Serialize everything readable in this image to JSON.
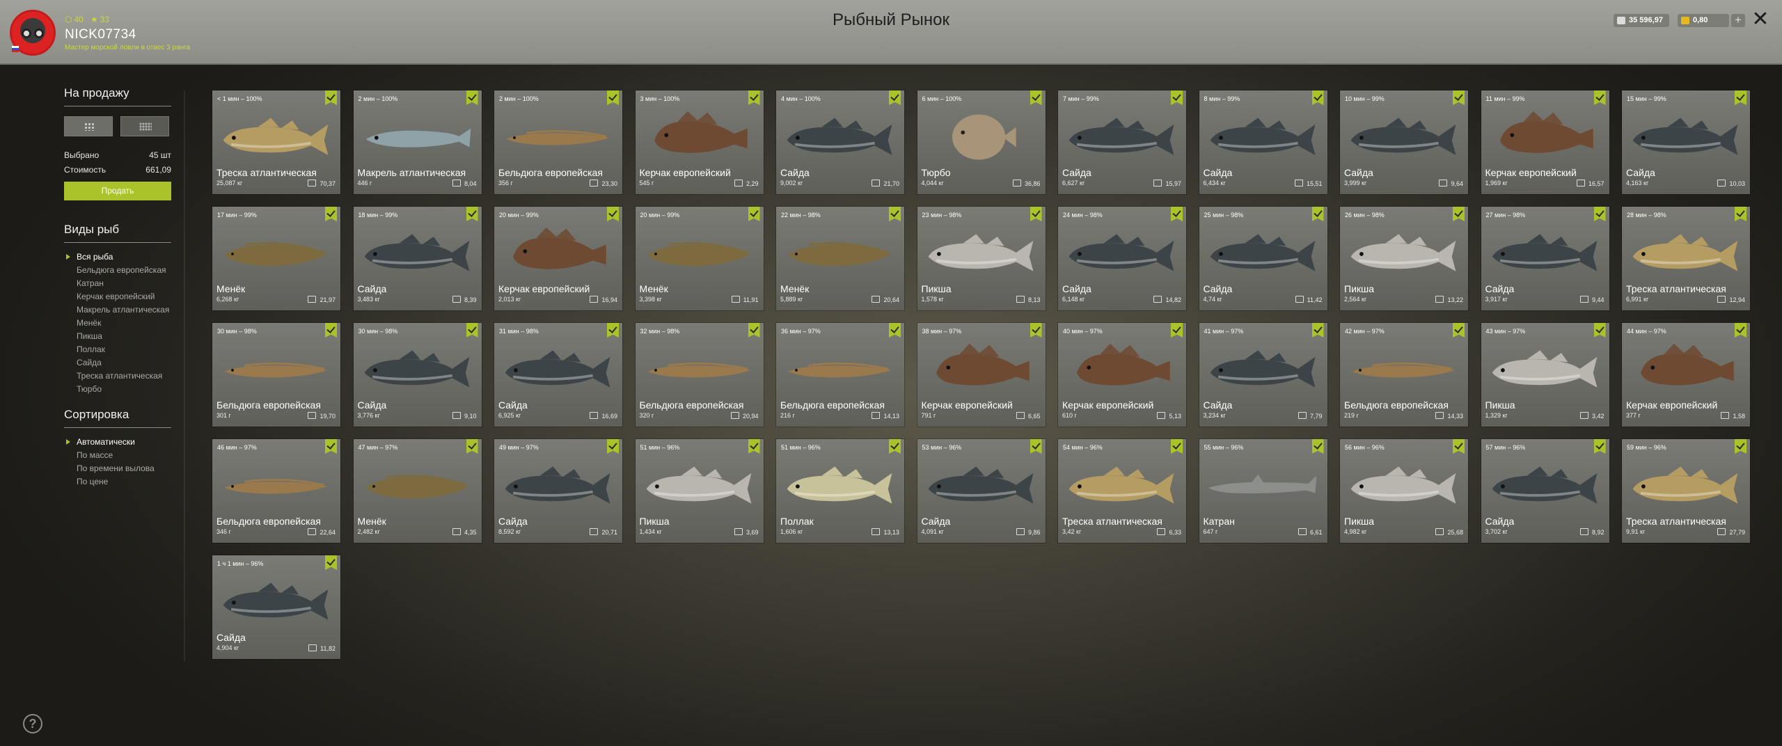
{
  "header": {
    "title": "Рыбный Рынок",
    "username": "NICK07734",
    "rank": "Мастер морской ловли в отвес 3 ранга",
    "stat_level": "40",
    "stat_stars": "33",
    "money": "35 596,97",
    "gold": "0,80",
    "plus": "+",
    "close": "✕"
  },
  "sidebar": {
    "sale_title": "На продажу",
    "selected_label": "Выбрано",
    "selected_value": "45 шт",
    "cost_label": "Стоимость",
    "cost_value": "661,09",
    "sell_button": "Продать",
    "types_title": "Виды рыб",
    "types": [
      "Вся рыба",
      "Бельдюга европейская",
      "Катран",
      "Керчак европейский",
      "Макрель атлантическая",
      "Менёк",
      "Пикша",
      "Поллак",
      "Сайда",
      "Треска атлантическая",
      "Тюрбо"
    ],
    "sort_title": "Сортировка",
    "sorts": [
      "Автоматически",
      "По массе",
      "По времени вылова",
      "По цене"
    ],
    "help": "?"
  },
  "cards": [
    {
      "time": "< 1 мин – 100%",
      "name": "Треска атлантическая",
      "weight": "25,087 кг",
      "price": "70,37"
    },
    {
      "time": "2 мин – 100%",
      "name": "Макрель атлантическая",
      "weight": "446 г",
      "price": "8,04"
    },
    {
      "time": "2 мин – 100%",
      "name": "Бельдюга европейская",
      "weight": "356 г",
      "price": "23,30"
    },
    {
      "time": "3 мин – 100%",
      "name": "Керчак европейский",
      "weight": "545 г",
      "price": "2,29"
    },
    {
      "time": "4 мин – 100%",
      "name": "Сайда",
      "weight": "9,002 кг",
      "price": "21,70"
    },
    {
      "time": "6 мин – 100%",
      "name": "Тюрбо",
      "weight": "4,044 кг",
      "price": "36,86"
    },
    {
      "time": "7 мин – 99%",
      "name": "Сайда",
      "weight": "6,627 кг",
      "price": "15,97"
    },
    {
      "time": "8 мин – 99%",
      "name": "Сайда",
      "weight": "6,434 кг",
      "price": "15,51"
    },
    {
      "time": "10 мин – 99%",
      "name": "Сайда",
      "weight": "3,999 кг",
      "price": "9,64"
    },
    {
      "time": "11 мин – 99%",
      "name": "Керчак европейский",
      "weight": "1,969 кг",
      "price": "16,57"
    },
    {
      "time": "15 мин – 99%",
      "name": "Сайда",
      "weight": "4,163 кг",
      "price": "10,03"
    },
    {
      "time": "17 мин – 99%",
      "name": "Менёк",
      "weight": "6,268 кг",
      "price": "21,97"
    },
    {
      "time": "18 мин – 99%",
      "name": "Сайда",
      "weight": "3,483 кг",
      "price": "8,39"
    },
    {
      "time": "20 мин – 99%",
      "name": "Керчак европейский",
      "weight": "2,013 кг",
      "price": "16,94"
    },
    {
      "time": "20 мин – 99%",
      "name": "Менёк",
      "weight": "3,398 кг",
      "price": "11,91"
    },
    {
      "time": "22 мин – 98%",
      "name": "Менёк",
      "weight": "5,889 кг",
      "price": "20,64"
    },
    {
      "time": "23 мин – 98%",
      "name": "Пикша",
      "weight": "1,578 кг",
      "price": "8,13"
    },
    {
      "time": "24 мин – 98%",
      "name": "Сайда",
      "weight": "6,148 кг",
      "price": "14,82"
    },
    {
      "time": "25 мин – 98%",
      "name": "Сайда",
      "weight": "4,74 кг",
      "price": "11,42"
    },
    {
      "time": "26 мин – 98%",
      "name": "Пикша",
      "weight": "2,564 кг",
      "price": "13,22"
    },
    {
      "time": "27 мин – 98%",
      "name": "Сайда",
      "weight": "3,917 кг",
      "price": "9,44"
    },
    {
      "time": "28 мин – 98%",
      "name": "Треска атлантическая",
      "weight": "6,991 кг",
      "price": "12,94"
    },
    {
      "time": "30 мин – 98%",
      "name": "Бельдюга европейская",
      "weight": "301 г",
      "price": "19,70"
    },
    {
      "time": "30 мин – 98%",
      "name": "Сайда",
      "weight": "3,776 кг",
      "price": "9,10"
    },
    {
      "time": "31 мин – 98%",
      "name": "Сайда",
      "weight": "6,925 кг",
      "price": "16,69"
    },
    {
      "time": "32 мин – 98%",
      "name": "Бельдюга европейская",
      "weight": "320 г",
      "price": "20,94"
    },
    {
      "time": "36 мин – 97%",
      "name": "Бельдюга европейская",
      "weight": "216 г",
      "price": "14,13"
    },
    {
      "time": "38 мин – 97%",
      "name": "Керчак европейский",
      "weight": "791 г",
      "price": "6,65"
    },
    {
      "time": "40 мин – 97%",
      "name": "Керчак европейский",
      "weight": "610 г",
      "price": "5,13"
    },
    {
      "time": "41 мин – 97%",
      "name": "Сайда",
      "weight": "3,234 кг",
      "price": "7,79"
    },
    {
      "time": "42 мин – 97%",
      "name": "Бельдюга европейская",
      "weight": "219 г",
      "price": "14,33"
    },
    {
      "time": "43 мин – 97%",
      "name": "Пикша",
      "weight": "1,329 кг",
      "price": "3,42"
    },
    {
      "time": "44 мин – 97%",
      "name": "Керчак европейский",
      "weight": "377 г",
      "price": "1,58"
    },
    {
      "time": "46 мин – 97%",
      "name": "Бельдюга европейская",
      "weight": "346 г",
      "price": "22,64"
    },
    {
      "time": "47 мин – 97%",
      "name": "Менёк",
      "weight": "2,482 кг",
      "price": "4,35"
    },
    {
      "time": "49 мин – 97%",
      "name": "Сайда",
      "weight": "8,592 кг",
      "price": "20,71"
    },
    {
      "time": "51 мин – 96%",
      "name": "Пикша",
      "weight": "1,434 кг",
      "price": "3,69"
    },
    {
      "time": "51 мин – 96%",
      "name": "Поллак",
      "weight": "1,606 кг",
      "price": "13,13"
    },
    {
      "time": "53 мин – 96%",
      "name": "Сайда",
      "weight": "4,091 кг",
      "price": "9,86"
    },
    {
      "time": "54 мин – 96%",
      "name": "Треска атлантическая",
      "weight": "3,42 кг",
      "price": "6,33"
    },
    {
      "time": "55 мин – 96%",
      "name": "Катран",
      "weight": "647 г",
      "price": "6,61"
    },
    {
      "time": "56 мин – 96%",
      "name": "Пикша",
      "weight": "4,982 кг",
      "price": "25,68"
    },
    {
      "time": "57 мин – 96%",
      "name": "Сайда",
      "weight": "3,702 кг",
      "price": "8,92"
    },
    {
      "time": "59 мин – 96%",
      "name": "Треска атлантическая",
      "weight": "9,91 кг",
      "price": "27,79"
    },
    {
      "time": "1 ч 1 мин – 96%",
      "name": "Сайда",
      "weight": "4,904 кг",
      "price": "11,82"
    }
  ],
  "fish_colors": {
    "Треска атлантическая": "#b49c62",
    "Макрель атлантическая": "#8fa2a8",
    "Бельдюга европейская": "#9a7a4c",
    "Керчак европейский": "#6e4a32",
    "Сайда": "#3c4448",
    "Тюрбо": "#a89478",
    "Менёк": "#7d6a3e",
    "Пикша": "#b8b6ae",
    "Поллак": "#c8c29a",
    "Катран": "#8c8e8c"
  },
  "fish_shapes": {
    "Треска атлантическая": "long",
    "Макрель атлантическая": "slim",
    "Бельдюга европейская": "eel",
    "Керчак европейский": "sculpin",
    "Сайда": "long",
    "Тюрбо": "flat",
    "Менёк": "eel2",
    "Пикша": "long",
    "Поллак": "long",
    "Катран": "shark"
  }
}
